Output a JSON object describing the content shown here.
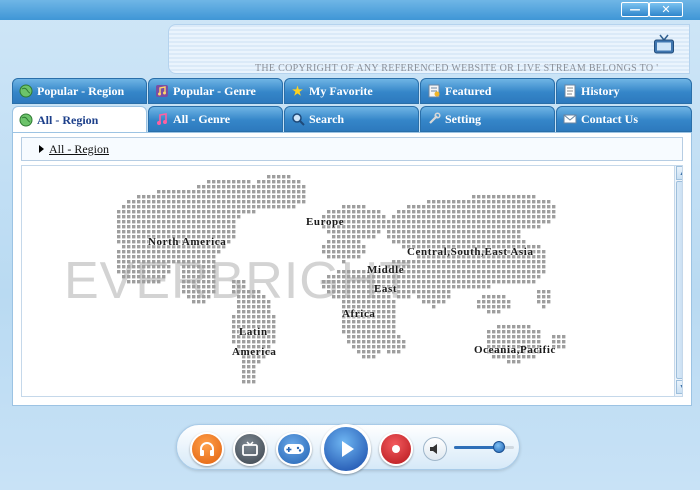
{
  "window": {
    "minimize_glyph": "—",
    "close_glyph": "✕"
  },
  "banner": {
    "copyright": "THE COPYRIGHT OF ANY REFERENCED WEBSITE OR LIVE STREAM BELONGS TO '"
  },
  "tabs": {
    "row1": [
      {
        "label": "Popular - Region",
        "icon": "globe-icon"
      },
      {
        "label": "Popular - Genre",
        "icon": "music-icon"
      },
      {
        "label": "My Favorite",
        "icon": "star-icon"
      },
      {
        "label": "Featured",
        "icon": "featured-icon"
      },
      {
        "label": "History",
        "icon": "history-icon"
      }
    ],
    "row2": [
      {
        "label": "All - Region",
        "icon": "globe-icon",
        "active": true
      },
      {
        "label": "All - Genre",
        "icon": "music-icon"
      },
      {
        "label": "Search",
        "icon": "search-icon"
      },
      {
        "label": "Setting",
        "icon": "wrench-icon"
      },
      {
        "label": "Contact Us",
        "icon": "mail-icon"
      }
    ]
  },
  "breadcrumb": {
    "current": "All - Region"
  },
  "map": {
    "watermark": "EVERBRIGHT",
    "regions": {
      "north_america": "North America",
      "europe": "Europe",
      "asia": "Central,South,East Asia",
      "middle_east_1": "Middle",
      "middle_east_2": "East",
      "africa": "Africa",
      "latin_1": "Latin",
      "latin_2": "America",
      "oceania": "Oceania,Pacific"
    }
  },
  "player": {
    "volume_percent": 75
  },
  "colors": {
    "tab_blue": "#3586c9",
    "play_blue": "#1f63b3",
    "record_red": "#d9262b",
    "headphone_orange": "#f07a1e"
  }
}
